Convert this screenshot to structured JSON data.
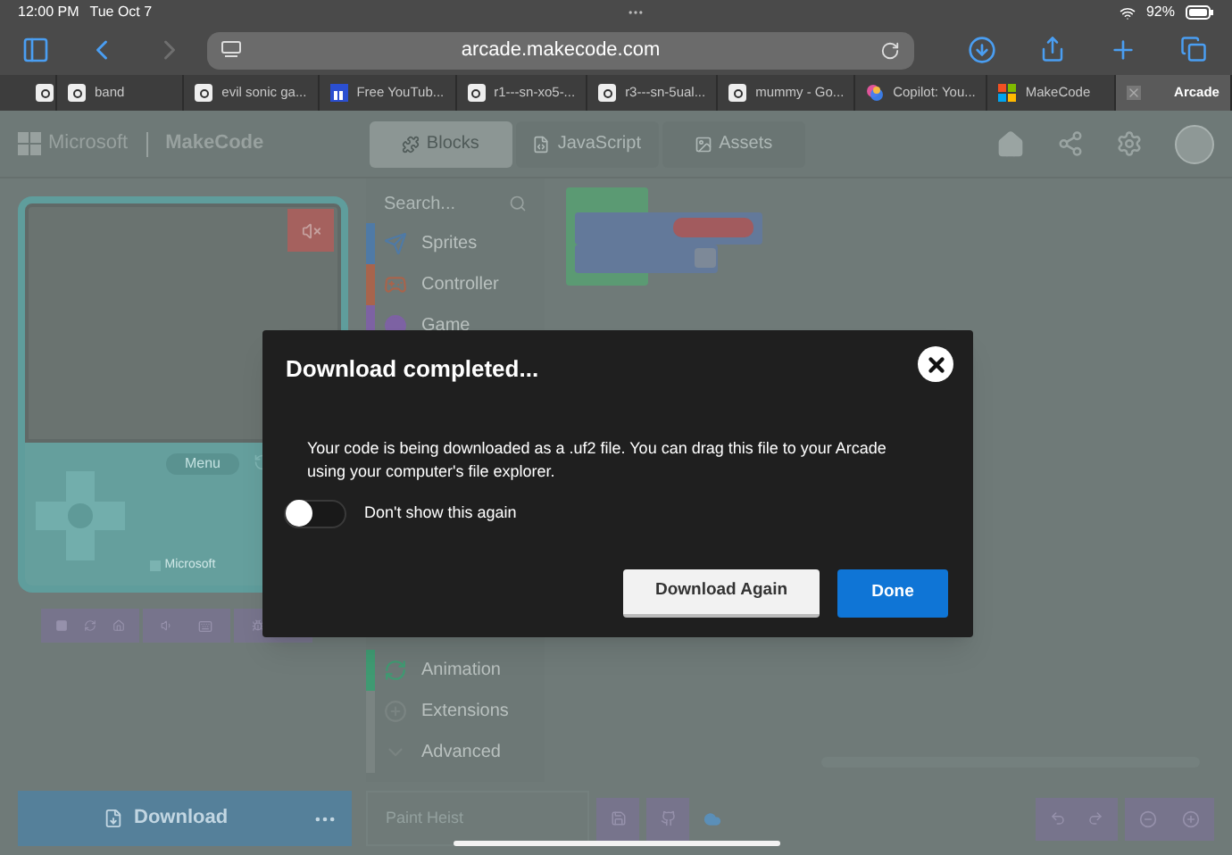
{
  "status_bar": {
    "time": "12:00 PM",
    "date": "Tue Oct 7",
    "battery": "92%"
  },
  "browser": {
    "url": "arcade.makecode.com",
    "forward_disabled": true
  },
  "tabs": [
    {
      "selected": false
    },
    {
      "label": "band",
      "selected": false
    },
    {
      "label": "evil sonic ga...",
      "selected": false
    },
    {
      "label": "Free YouTub...",
      "selected": false
    },
    {
      "label": "r1---sn-xo5-...",
      "selected": false
    },
    {
      "label": "r3---sn-5ual...",
      "selected": false
    },
    {
      "label": "mummy - Go...",
      "selected": false
    },
    {
      "label": "Copilot: You...",
      "selected": false
    },
    {
      "label": "MakeCode",
      "selected": false
    },
    {
      "label": "Arcade",
      "selected": true
    }
  ],
  "header": {
    "brand": "Microsoft",
    "product": "MakeCode",
    "editor_tabs": [
      {
        "label": "Blocks",
        "selected": true
      },
      {
        "label": "JavaScript",
        "selected": false
      },
      {
        "label": "Assets",
        "selected": false
      }
    ]
  },
  "simulator": {
    "menu_label": "Menu",
    "maker": "Microsoft"
  },
  "toolbox": {
    "search": {
      "placeholder": "Search..."
    },
    "categories": [
      {
        "label": "Sprites",
        "color": "#4f7aa6"
      },
      {
        "label": "Controller",
        "color": "#a8644c"
      },
      {
        "label": "Game",
        "color": "#7d62a3"
      }
    ],
    "lower_categories": [
      {
        "label": "Animation",
        "color": "#3f9a72"
      },
      {
        "label": "Extensions",
        "color": "#7a8482"
      },
      {
        "label": "Advanced",
        "color": "#7a8482"
      }
    ]
  },
  "download": {
    "label": "Download"
  },
  "project": {
    "name": "Paint Heist"
  },
  "dialog": {
    "title": "Download completed...",
    "body": "Your code is being downloaded as a .uf2 file. You can drag this file to your Arcade using your computer's file explorer.",
    "toggle": {
      "label": "Don't show this again",
      "on": false
    },
    "buttons": [
      {
        "label": "Download Again",
        "kind": "secondary"
      },
      {
        "label": "Done",
        "kind": "primary"
      }
    ]
  }
}
